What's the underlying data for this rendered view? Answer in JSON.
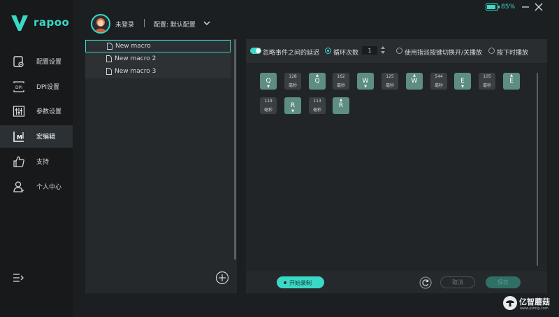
{
  "app": {
    "brand": "rapoo",
    "accent_color": "#3ad9c6"
  },
  "sidebar": {
    "items": [
      {
        "label": "配置设置",
        "icon": "config-settings-icon"
      },
      {
        "label": "DPI设置",
        "icon": "dpi-icon"
      },
      {
        "label": "参数设置",
        "icon": "sliders-icon"
      },
      {
        "label": "宏编辑",
        "icon": "macro-icon",
        "active": true
      },
      {
        "label": "支持",
        "icon": "thumbs-up-icon"
      },
      {
        "label": "个人中心",
        "icon": "user-icon"
      }
    ],
    "menu_icon": "collapse-menu-icon"
  },
  "header": {
    "login_status": "未登录",
    "config_label": "配置: 默认配置",
    "battery": "85%",
    "battery_level": 0.85
  },
  "macro_list": {
    "items": [
      "New macro",
      "New macro 2",
      "New macro 3"
    ],
    "selected_index": 0
  },
  "options": {
    "ignore_delay_label": "忽略事件之间的延迟",
    "ignore_delay_on": true,
    "loop_label": "循环次数",
    "loop_count": "1",
    "toggle_label": "使用指派按键切换开/关播放",
    "hold_label": "按下时播放",
    "selected_mode": "loop"
  },
  "events": {
    "row1": [
      {
        "type": "key",
        "key": "Q",
        "dir": "down"
      },
      {
        "type": "delay",
        "ms": "128",
        "unit": "毫秒"
      },
      {
        "type": "key",
        "key": "Q",
        "dir": "up"
      },
      {
        "type": "delay",
        "ms": "162",
        "unit": "毫秒"
      },
      {
        "type": "key",
        "key": "W",
        "dir": "down"
      },
      {
        "type": "delay",
        "ms": "125",
        "unit": "毫秒"
      },
      {
        "type": "key",
        "key": "W",
        "dir": "up"
      },
      {
        "type": "delay",
        "ms": "544",
        "unit": "毫秒"
      },
      {
        "type": "key",
        "key": "E",
        "dir": "down"
      },
      {
        "type": "delay",
        "ms": "105",
        "unit": "毫秒"
      },
      {
        "type": "key",
        "key": "E",
        "dir": "up"
      }
    ],
    "row2": [
      {
        "type": "delay",
        "ms": "119",
        "unit": "毫秒"
      },
      {
        "type": "key",
        "key": "R",
        "dir": "down"
      },
      {
        "type": "delay",
        "ms": "113",
        "unit": "毫秒"
      },
      {
        "type": "key",
        "key": "R",
        "dir": "up"
      }
    ]
  },
  "actions": {
    "record_label": "开始录制",
    "cancel_label": "取消",
    "save_label": "保存"
  },
  "watermark": {
    "text": "亿智蘑菇",
    "url": "www.yizmg.com"
  }
}
